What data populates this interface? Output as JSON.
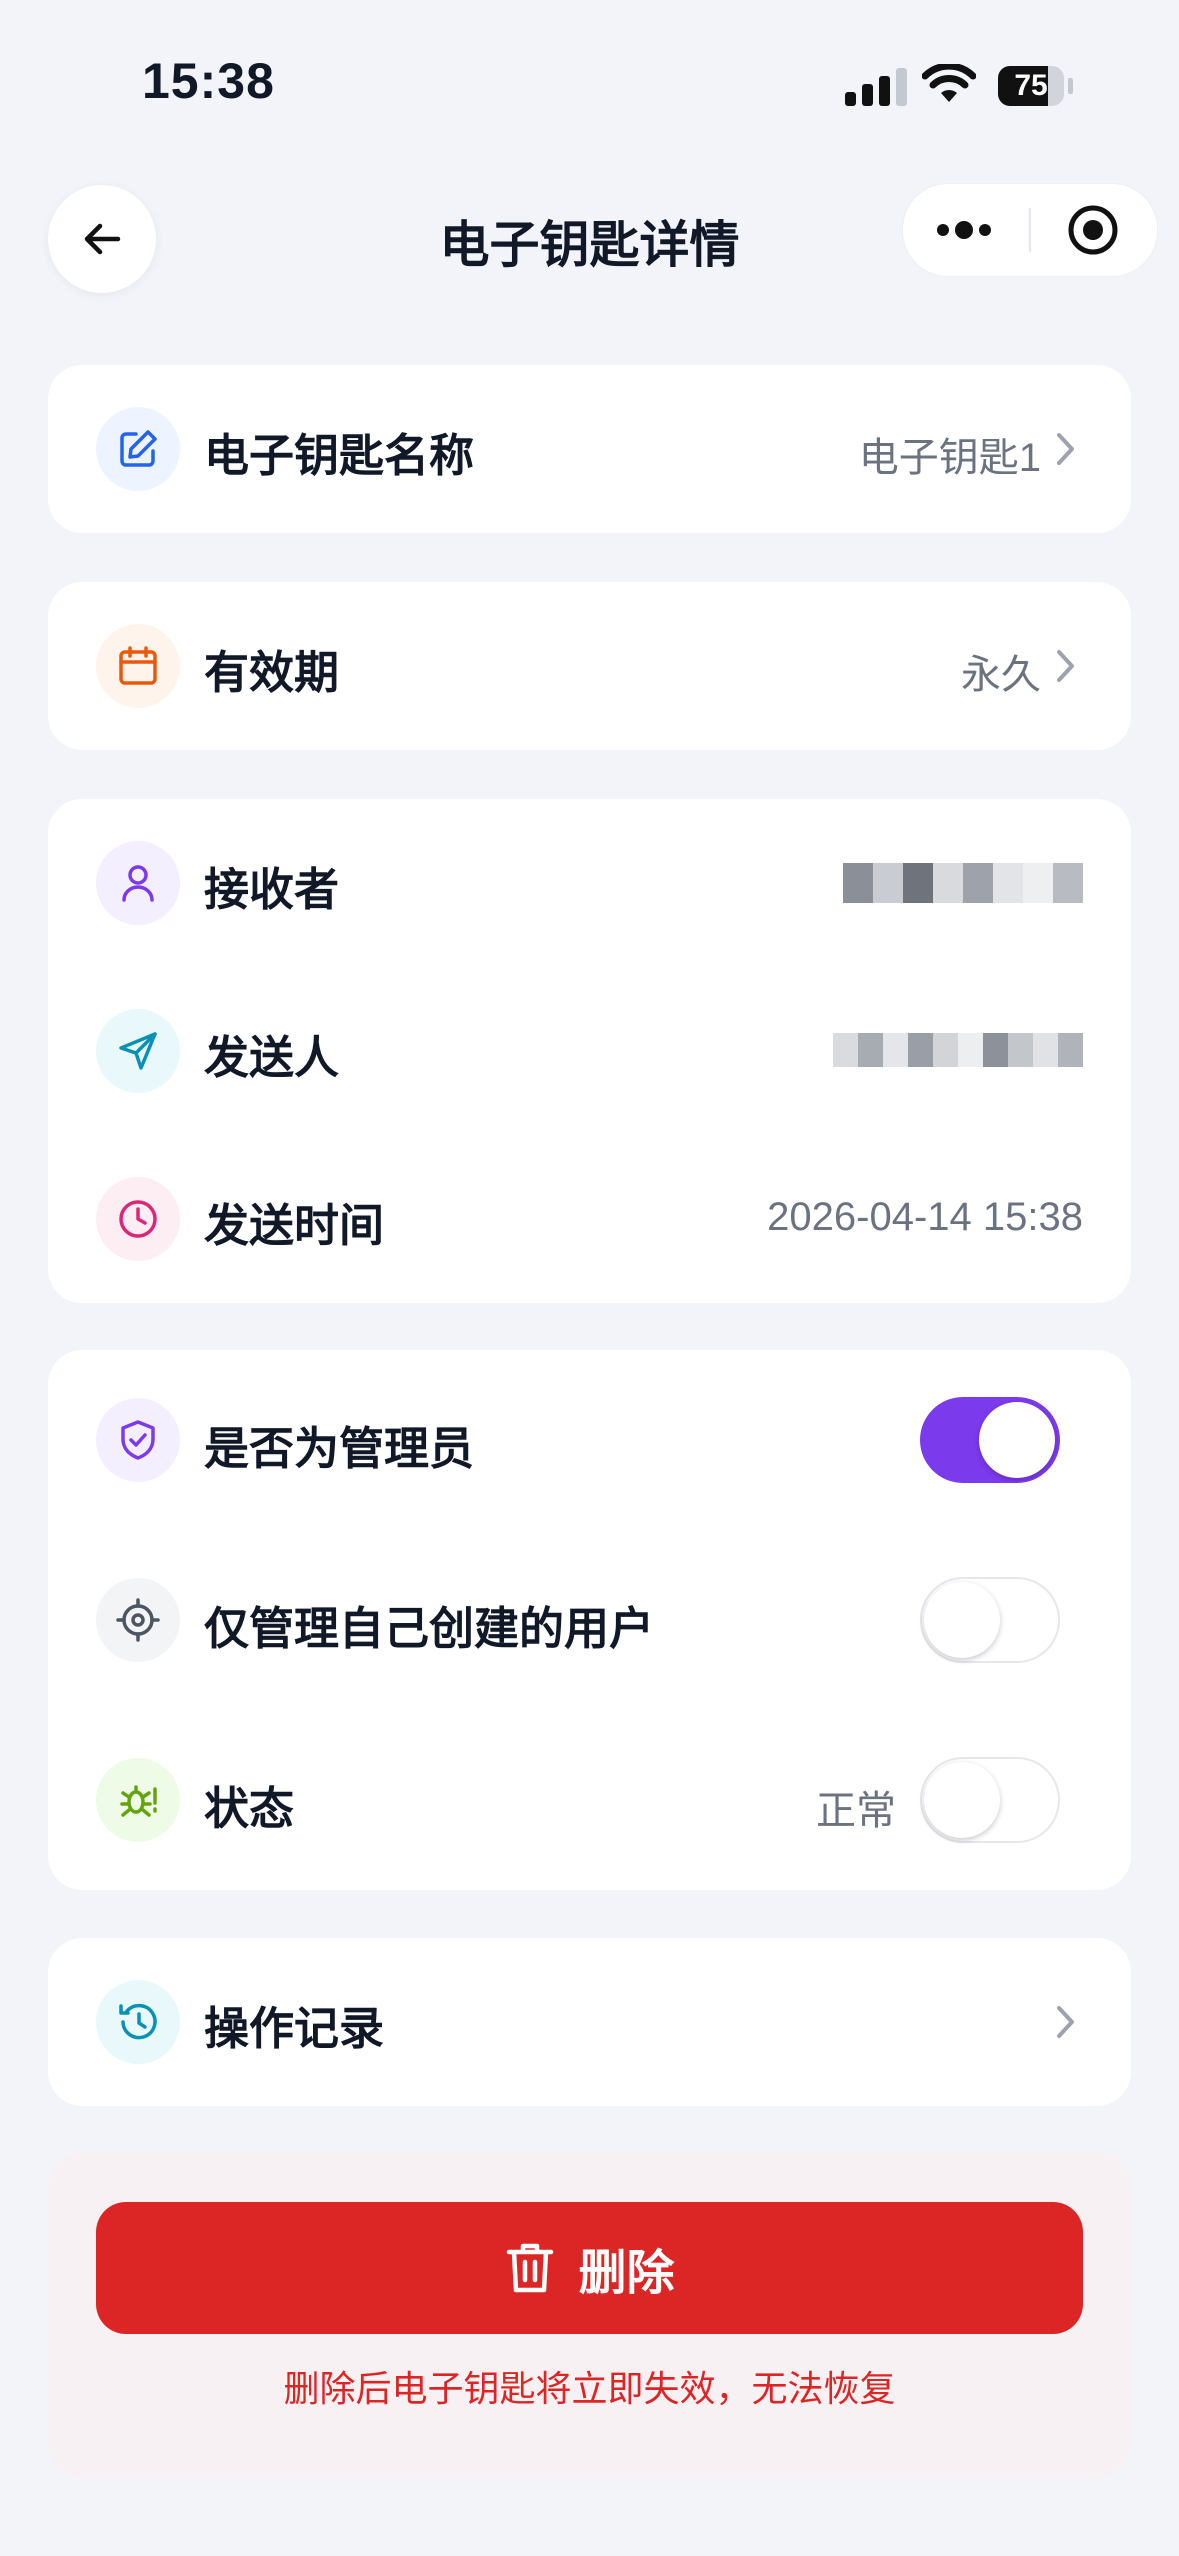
{
  "status_bar": {
    "time": "15:38",
    "battery": "75"
  },
  "header": {
    "title": "电子钥匙详情"
  },
  "key_name": {
    "label": "电子钥匙名称",
    "value": "电子钥匙1"
  },
  "validity": {
    "label": "有效期",
    "value": "永久"
  },
  "people": {
    "receiver_label": "接收者",
    "sender_label": "发送人",
    "send_time_label": "发送时间",
    "send_time_value": "2026-04-14 15:38"
  },
  "permissions": {
    "is_admin_label": "是否为管理员",
    "is_admin_on": true,
    "own_users_label": "仅管理自己创建的用户",
    "own_users_on": false,
    "status_label": "状态",
    "status_value": "正常",
    "status_on": false
  },
  "records": {
    "label": "操作记录"
  },
  "danger": {
    "delete_label": "删除",
    "warning": "删除后电子钥匙将立即失效，无法恢复"
  },
  "colors": {
    "accent": "#7c3aed",
    "danger": "#dc2626",
    "background": "#f2f4f9"
  },
  "icons": [
    "back-arrow-icon",
    "more-icon",
    "target-icon",
    "edit-icon",
    "calendar-icon",
    "user-icon",
    "send-icon",
    "clock-icon",
    "shield-icon",
    "crosshair-icon",
    "bug-icon",
    "history-icon",
    "trash-icon",
    "chevron-right-icon"
  ]
}
